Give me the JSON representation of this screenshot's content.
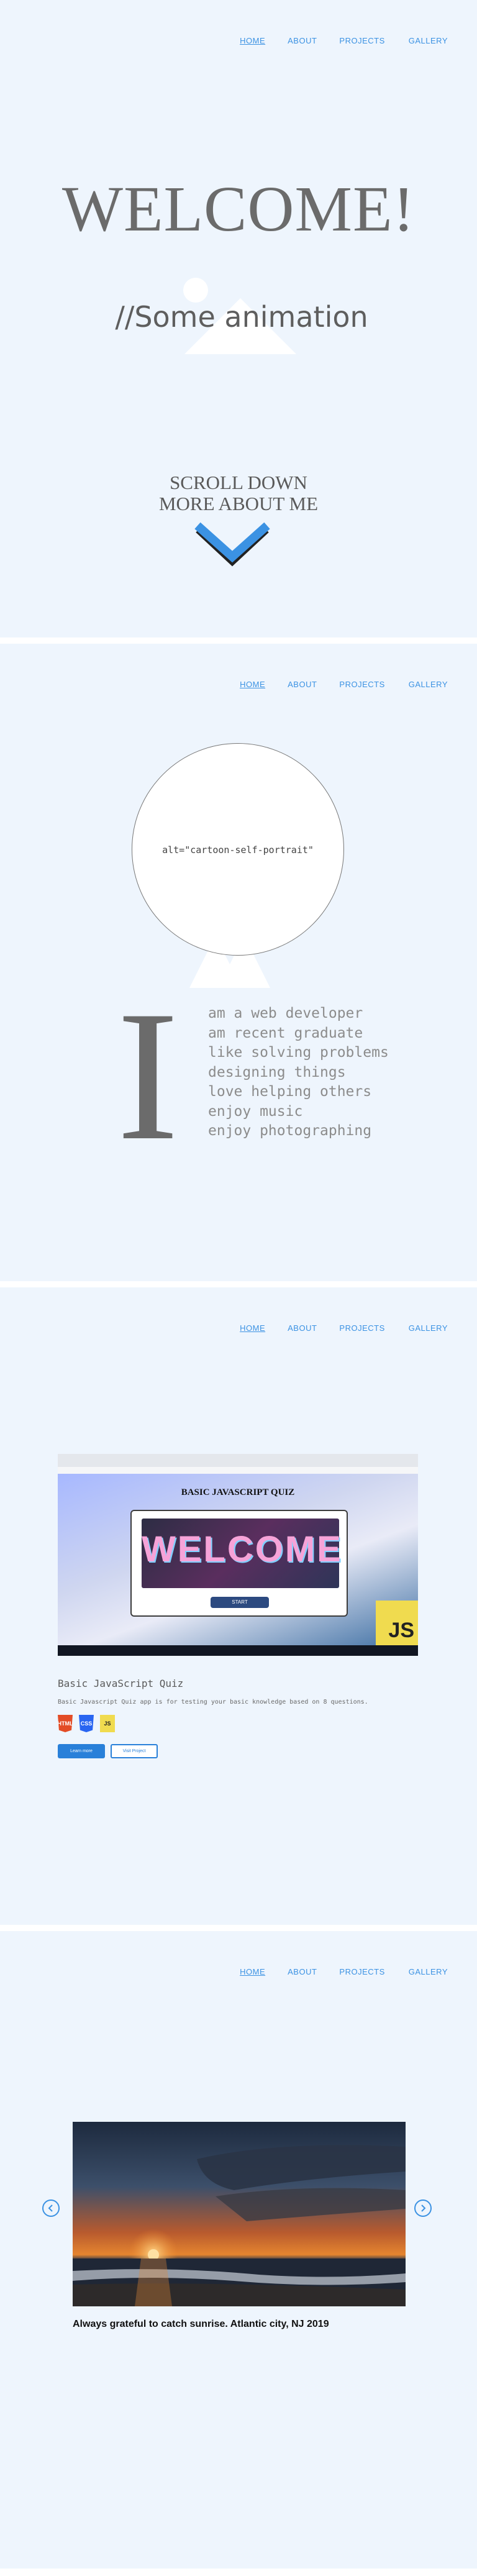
{
  "nav": {
    "items": [
      {
        "label": "HOME"
      },
      {
        "label": "ABOUT"
      },
      {
        "label": "PROJECTS"
      },
      {
        "label": "GALLERY"
      }
    ]
  },
  "hero": {
    "title": "WELCOME!",
    "subtitle": "//Some animation",
    "scroll_line1": "SCROLL DOWN",
    "scroll_line2": "MORE ABOUT ME",
    "chevron_icon": "chevron-down-icon",
    "accent_color": "#3b92e3"
  },
  "about": {
    "portrait_alt": "alt=\"cartoon-self-portrait\"",
    "big_letter": "I",
    "lines": [
      "am a web developer",
      "am recent graduate",
      "like solving problems",
      "designing things",
      "love helping others",
      "enjoy music",
      "enjoy photographing"
    ]
  },
  "projects": {
    "screenshot": {
      "quiz_title": "BASIC JAVASCRIPT QUIZ",
      "welcome_text": "WELCOME",
      "start_label": "START",
      "js_label": "JS"
    },
    "title": "Basic JavaScript Quiz",
    "description": "Basic Javascript Quiz app is for testing your basic knowledge based on 8 questions.",
    "badges": [
      "HTML",
      "CSS",
      "JS"
    ],
    "btn_primary": "Learn more",
    "btn_secondary": "Visit Project"
  },
  "gallery": {
    "caption": "Always grateful to catch sunrise. Atlantic city, NJ 2019",
    "prev_icon": "chevron-left-icon",
    "next_icon": "chevron-right-icon"
  }
}
